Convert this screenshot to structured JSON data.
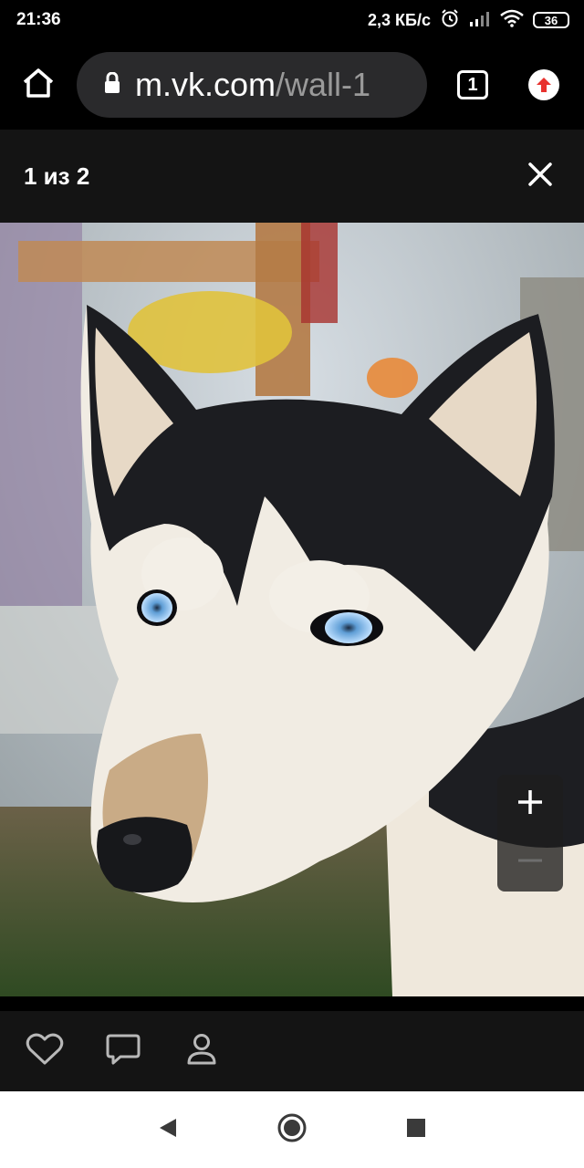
{
  "status_bar": {
    "time": "21:36",
    "network_speed": "2,3 КБ/с",
    "battery_level": "36",
    "icons": [
      "alarm-icon",
      "signal-icon",
      "wifi-icon",
      "battery-icon"
    ]
  },
  "browser": {
    "url_host": "m.vk.com",
    "url_path": "/wall-1",
    "tabs_count": "1",
    "icons": [
      "home-icon",
      "lock-icon",
      "update-arrow-icon"
    ],
    "accent_color": "#e8322e"
  },
  "viewer": {
    "counter": "1 из 2",
    "close_icon": "close-icon",
    "photo_subject": "husky-dog-photo",
    "zoom": {
      "in_icon": "plus-icon",
      "out_icon": "minus-icon"
    }
  },
  "actions": {
    "icons": [
      "heart-icon",
      "comment-icon",
      "person-icon"
    ]
  },
  "nav": {
    "icons": [
      "back-icon",
      "home-circle-icon",
      "recents-icon"
    ]
  }
}
